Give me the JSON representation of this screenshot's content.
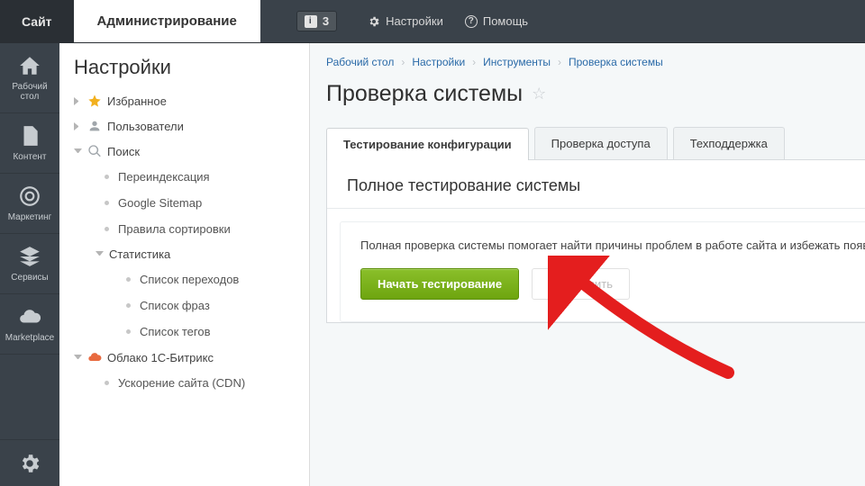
{
  "topbar": {
    "site_tab": "Сайт",
    "admin_tab": "Администрирование",
    "notification_count": "3",
    "settings_label": "Настройки",
    "help_label": "Помощь"
  },
  "rail": {
    "items": [
      {
        "id": "desktop",
        "label": "Рабочий\nстол",
        "icon": "house-icon"
      },
      {
        "id": "content",
        "label": "Контент",
        "icon": "document-icon"
      },
      {
        "id": "marketing",
        "label": "Маркетинг",
        "icon": "target-icon"
      },
      {
        "id": "services",
        "label": "Сервисы",
        "icon": "layers-icon"
      },
      {
        "id": "marketplace",
        "label": "Marketplace",
        "icon": "cloud-down-icon"
      }
    ]
  },
  "submenu": {
    "title": "Настройки",
    "favorites": "Избранное",
    "users": "Пользователи",
    "search": "Поиск",
    "search_children": {
      "reindex": "Переиндексация",
      "sitemap": "Google Sitemap",
      "sortrules": "Правила сортировки"
    },
    "statistics": "Статистика",
    "stat_children": {
      "transitions": "Список переходов",
      "phrases": "Список фраз",
      "tags": "Список тегов"
    },
    "cloud": "Облако 1С-Битрикс",
    "cloud_children": {
      "cdn": "Ускорение сайта (CDN)"
    }
  },
  "breadcrumb": {
    "items": [
      "Рабочий стол",
      "Настройки",
      "Инструменты",
      "Проверка системы"
    ]
  },
  "page": {
    "title": "Проверка системы"
  },
  "tabs": {
    "config": "Тестирование конфигурации",
    "access": "Проверка доступа",
    "support": "Техподдержка"
  },
  "panel": {
    "heading": "Полное тестирование системы",
    "description": "Полная проверка системы помогает найти причины проблем в работе сайта и избежать появл",
    "start_btn": "Начать тестирование",
    "stop_btn": "Остановить"
  },
  "colors": {
    "accent_green": "#7ab51d",
    "header_dark": "#3a424a"
  }
}
